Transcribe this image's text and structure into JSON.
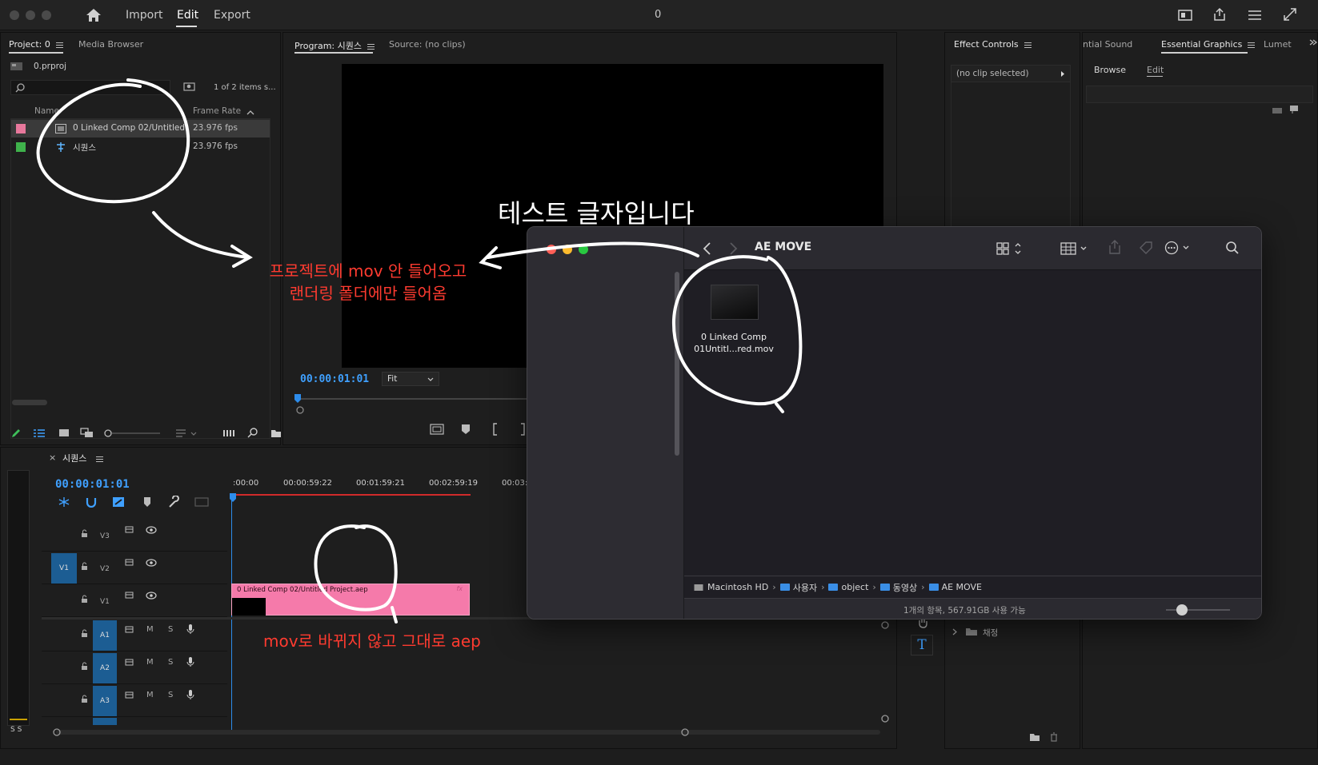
{
  "topbar": {
    "menu": [
      "Import",
      "Edit",
      "Export"
    ],
    "active": "Edit",
    "center_title": "0"
  },
  "project_panel": {
    "tabs": [
      "Project: 0",
      "Media Browser"
    ],
    "project_file": "0.prproj",
    "item_count": "1 of 2 items s...",
    "columns": [
      "Name",
      "Frame Rate"
    ],
    "rows": [
      {
        "name": "0 Linked Comp 02/Untitled",
        "frame_rate": "23.976 fps",
        "color": "#e8789c"
      },
      {
        "name": "시퀀스",
        "frame_rate": "23.976 fps",
        "color": "#3fb24b"
      }
    ]
  },
  "program_monitor": {
    "tabs": [
      "Program: 시퀀스",
      "Source: (no clips)"
    ],
    "timecode": "00:00:01:01",
    "zoom": "Fit"
  },
  "effect_controls": {
    "tab": "Effect Controls",
    "no_clip": "(no clip selected)"
  },
  "essential_graphics": {
    "tabs": [
      "ntial Sound",
      "Essential Graphics",
      "Lumet"
    ],
    "subtabs": [
      "Browse",
      "Edit"
    ],
    "folder": "채정"
  },
  "timeline": {
    "sequence_name": "시퀀스",
    "timecode": "00:00:01:01",
    "ruler": [
      ":00:00",
      "00:00:59:22",
      "00:01:59:21",
      "00:02:59:19",
      "00:03:"
    ],
    "tracks": [
      {
        "id": "V3",
        "kind": "video"
      },
      {
        "id": "V2",
        "kind": "video",
        "source": "V1"
      },
      {
        "id": "V1",
        "kind": "video"
      },
      {
        "id": "A1",
        "kind": "audio"
      },
      {
        "id": "A2",
        "kind": "audio"
      },
      {
        "id": "A3",
        "kind": "audio"
      }
    ],
    "clip_label": "0 Linked Comp 02/Untitled Project.aep",
    "mute": "M",
    "solo": "S",
    "meter_label": "S S"
  },
  "finder": {
    "title": "AE MOVE",
    "file_name_line1": "0 Linked Comp",
    "file_name_line2": "01Untitl...red.mov",
    "path": [
      "Macintosh HD",
      "사용자",
      "object",
      "동영상",
      "AE MOVE"
    ],
    "status": "1개의 항목, 567.91GB 사용 가능"
  },
  "annotations": {
    "white_title": "테스트 글자입니다",
    "red_1_line1": "프로젝트에 mov 안 들어오고",
    "red_1_line2": "랜더링 폴더에만 들어옴",
    "red_2": "mov로 바뀌지 않고 그대로 aep"
  }
}
